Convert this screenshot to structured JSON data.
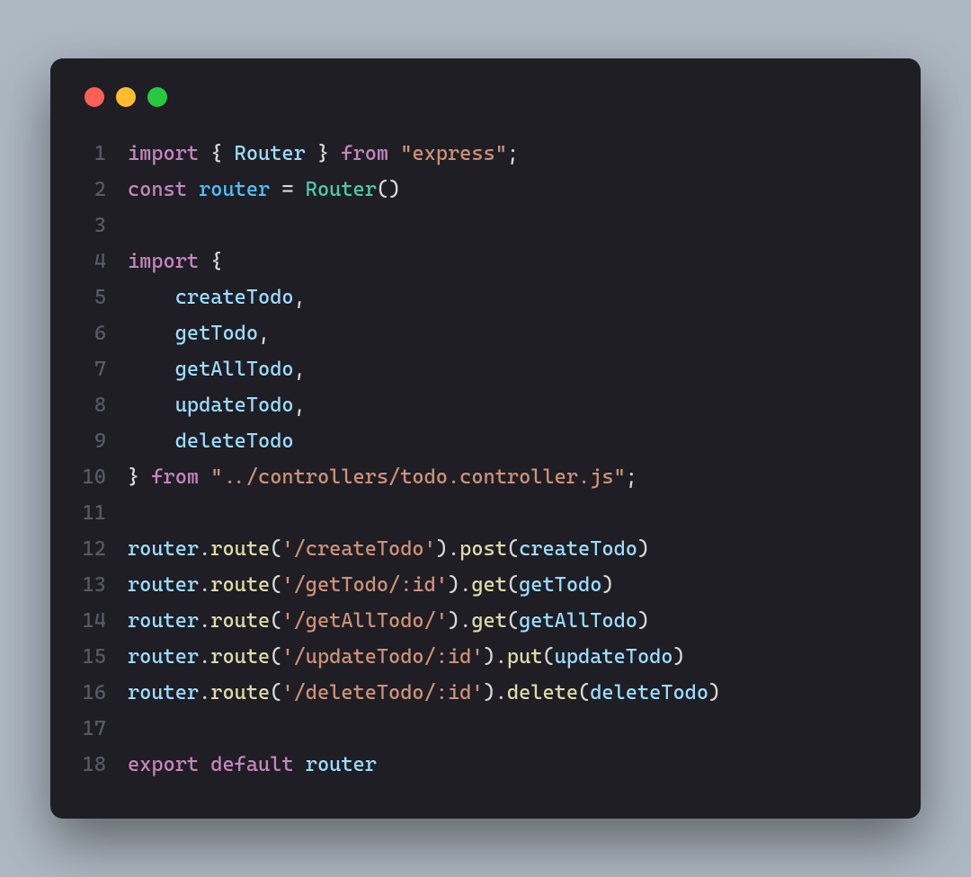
{
  "window": {
    "dots": [
      "red",
      "yellow",
      "green"
    ]
  },
  "lines": [
    {
      "n": "1",
      "tokens": [
        {
          "t": "import",
          "c": "kw"
        },
        {
          "t": " ",
          "c": "pn"
        },
        {
          "t": "{",
          "c": "pn"
        },
        {
          "t": " ",
          "c": "pn"
        },
        {
          "t": "Router",
          "c": "id"
        },
        {
          "t": " ",
          "c": "pn"
        },
        {
          "t": "}",
          "c": "pn"
        },
        {
          "t": " ",
          "c": "pn"
        },
        {
          "t": "from",
          "c": "kw"
        },
        {
          "t": " ",
          "c": "pn"
        },
        {
          "t": "\"express\"",
          "c": "str"
        },
        {
          "t": ";",
          "c": "pn"
        }
      ]
    },
    {
      "n": "2",
      "tokens": [
        {
          "t": "const",
          "c": "kw"
        },
        {
          "t": " ",
          "c": "pn"
        },
        {
          "t": "router",
          "c": "cn"
        },
        {
          "t": " = ",
          "c": "pn"
        },
        {
          "t": "Router",
          "c": "tp"
        },
        {
          "t": "()",
          "c": "pn"
        }
      ]
    },
    {
      "n": "3",
      "tokens": []
    },
    {
      "n": "4",
      "tokens": [
        {
          "t": "import",
          "c": "kw"
        },
        {
          "t": " ",
          "c": "pn"
        },
        {
          "t": "{",
          "c": "pn"
        }
      ]
    },
    {
      "n": "5",
      "tokens": [
        {
          "t": "    ",
          "c": "pn"
        },
        {
          "t": "createTodo",
          "c": "id"
        },
        {
          "t": ",",
          "c": "pn"
        }
      ]
    },
    {
      "n": "6",
      "tokens": [
        {
          "t": "    ",
          "c": "pn"
        },
        {
          "t": "getTodo",
          "c": "id"
        },
        {
          "t": ",",
          "c": "pn"
        }
      ]
    },
    {
      "n": "7",
      "tokens": [
        {
          "t": "    ",
          "c": "pn"
        },
        {
          "t": "getAllTodo",
          "c": "id"
        },
        {
          "t": ",",
          "c": "pn"
        }
      ]
    },
    {
      "n": "8",
      "tokens": [
        {
          "t": "    ",
          "c": "pn"
        },
        {
          "t": "updateTodo",
          "c": "id"
        },
        {
          "t": ",",
          "c": "pn"
        }
      ]
    },
    {
      "n": "9",
      "tokens": [
        {
          "t": "    ",
          "c": "pn"
        },
        {
          "t": "deleteTodo",
          "c": "id"
        }
      ]
    },
    {
      "n": "10",
      "tokens": [
        {
          "t": "}",
          "c": "pn"
        },
        {
          "t": " ",
          "c": "pn"
        },
        {
          "t": "from",
          "c": "kw"
        },
        {
          "t": " ",
          "c": "pn"
        },
        {
          "t": "\"../controllers/todo.controller.js\"",
          "c": "str"
        },
        {
          "t": ";",
          "c": "pn"
        }
      ]
    },
    {
      "n": "11",
      "tokens": []
    },
    {
      "n": "12",
      "tokens": [
        {
          "t": "router",
          "c": "id"
        },
        {
          "t": ".",
          "c": "pn"
        },
        {
          "t": "route",
          "c": "fn"
        },
        {
          "t": "(",
          "c": "pn"
        },
        {
          "t": "'/createTodo'",
          "c": "str"
        },
        {
          "t": ").",
          "c": "pn"
        },
        {
          "t": "post",
          "c": "fn"
        },
        {
          "t": "(",
          "c": "pn"
        },
        {
          "t": "createTodo",
          "c": "id"
        },
        {
          "t": ")",
          "c": "pn"
        }
      ]
    },
    {
      "n": "13",
      "tokens": [
        {
          "t": "router",
          "c": "id"
        },
        {
          "t": ".",
          "c": "pn"
        },
        {
          "t": "route",
          "c": "fn"
        },
        {
          "t": "(",
          "c": "pn"
        },
        {
          "t": "'/getTodo/:id'",
          "c": "str"
        },
        {
          "t": ").",
          "c": "pn"
        },
        {
          "t": "get",
          "c": "fn"
        },
        {
          "t": "(",
          "c": "pn"
        },
        {
          "t": "getTodo",
          "c": "id"
        },
        {
          "t": ")",
          "c": "pn"
        }
      ]
    },
    {
      "n": "14",
      "tokens": [
        {
          "t": "router",
          "c": "id"
        },
        {
          "t": ".",
          "c": "pn"
        },
        {
          "t": "route",
          "c": "fn"
        },
        {
          "t": "(",
          "c": "pn"
        },
        {
          "t": "'/getAllTodo/'",
          "c": "str"
        },
        {
          "t": ").",
          "c": "pn"
        },
        {
          "t": "get",
          "c": "fn"
        },
        {
          "t": "(",
          "c": "pn"
        },
        {
          "t": "getAllTodo",
          "c": "id"
        },
        {
          "t": ")",
          "c": "pn"
        }
      ]
    },
    {
      "n": "15",
      "tokens": [
        {
          "t": "router",
          "c": "id"
        },
        {
          "t": ".",
          "c": "pn"
        },
        {
          "t": "route",
          "c": "fn"
        },
        {
          "t": "(",
          "c": "pn"
        },
        {
          "t": "'/updateTodo/:id'",
          "c": "str"
        },
        {
          "t": ").",
          "c": "pn"
        },
        {
          "t": "put",
          "c": "fn"
        },
        {
          "t": "(",
          "c": "pn"
        },
        {
          "t": "updateTodo",
          "c": "id"
        },
        {
          "t": ")",
          "c": "pn"
        }
      ]
    },
    {
      "n": "16",
      "tokens": [
        {
          "t": "router",
          "c": "id"
        },
        {
          "t": ".",
          "c": "pn"
        },
        {
          "t": "route",
          "c": "fn"
        },
        {
          "t": "(",
          "c": "pn"
        },
        {
          "t": "'/deleteTodo/:id'",
          "c": "str"
        },
        {
          "t": ").",
          "c": "pn"
        },
        {
          "t": "delete",
          "c": "fn"
        },
        {
          "t": "(",
          "c": "pn"
        },
        {
          "t": "deleteTodo",
          "c": "id"
        },
        {
          "t": ")",
          "c": "pn"
        }
      ]
    },
    {
      "n": "17",
      "tokens": []
    },
    {
      "n": "18",
      "tokens": [
        {
          "t": "export",
          "c": "kw"
        },
        {
          "t": " ",
          "c": "pn"
        },
        {
          "t": "default",
          "c": "kw"
        },
        {
          "t": " ",
          "c": "pn"
        },
        {
          "t": "router",
          "c": "id"
        }
      ]
    }
  ]
}
